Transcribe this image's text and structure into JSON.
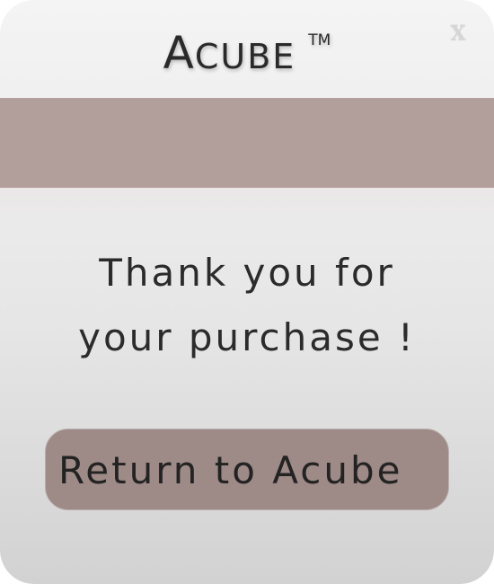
{
  "window": {
    "title_first": "A",
    "title_rest": "CUBE",
    "trademark": "TM",
    "close_label": "X"
  },
  "main": {
    "message_line1": "Thank you for",
    "message_line2": "your purchase !",
    "return_button_label": "Return to Acube"
  },
  "colors": {
    "accent_band": "#b29e9a",
    "button_fill": "#9e8a86",
    "text": "#2b2b2b"
  }
}
